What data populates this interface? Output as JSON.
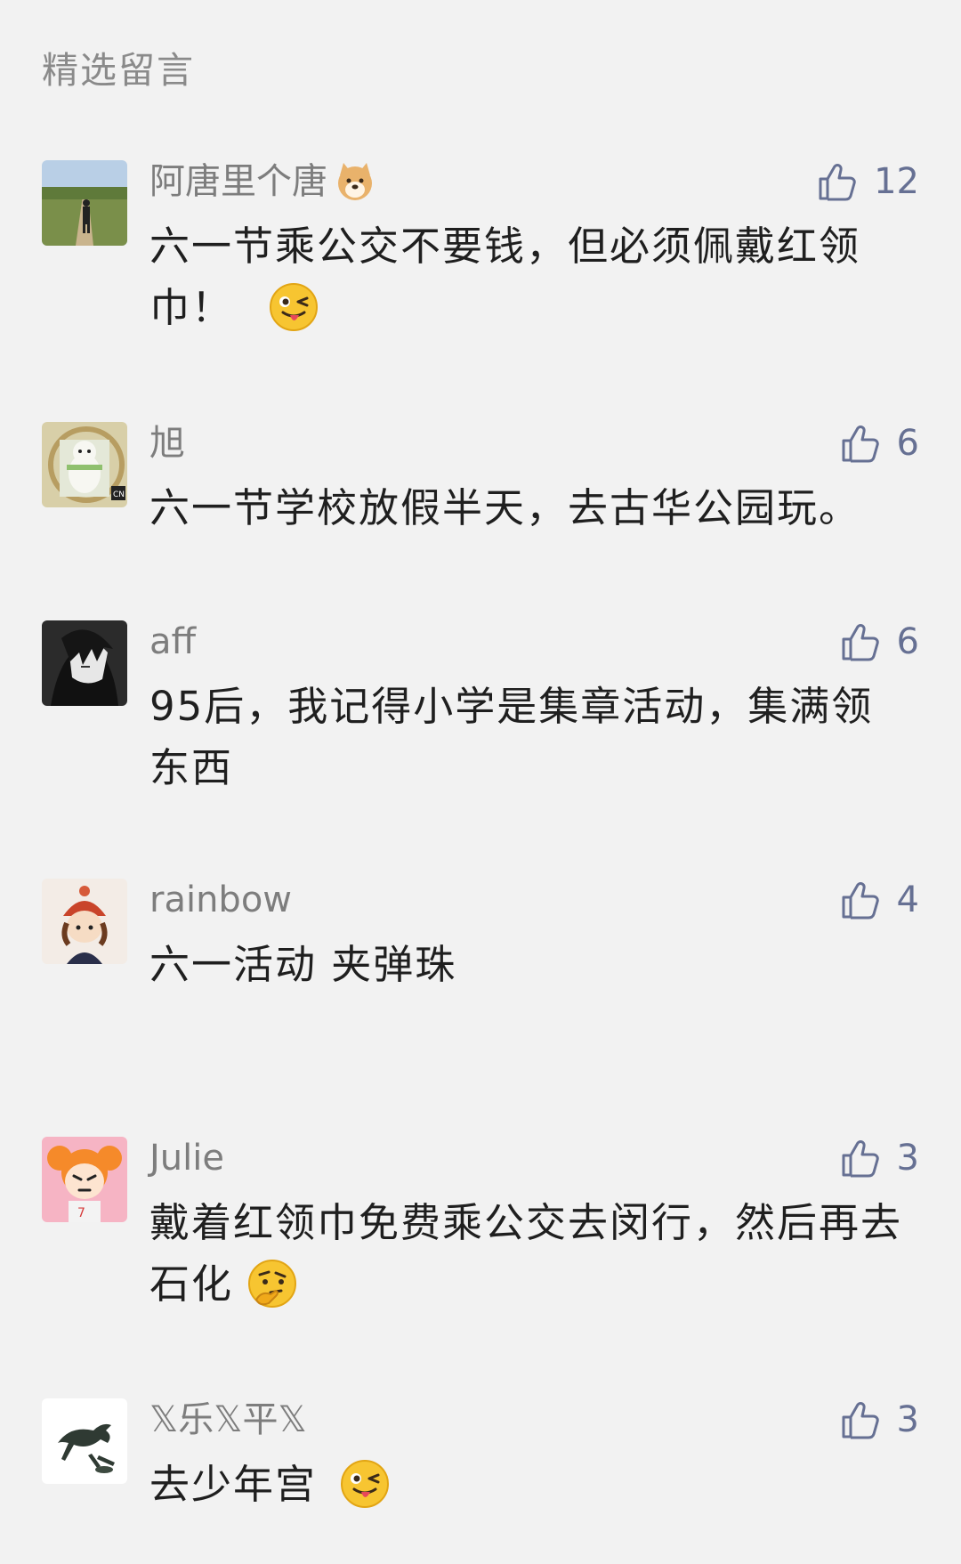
{
  "section_title": "精选留言",
  "comments": [
    {
      "name": "阿唐里个唐",
      "name_emoji": "dog-face-emoji",
      "likes": "12",
      "text": "六一节乘公交不要钱，但必须佩戴红领巾！",
      "text_emoji": "winking-tongue-emoji",
      "avatar": "road-walker-avatar"
    },
    {
      "name": "旭",
      "likes": "6",
      "text": "六一节学校放假半天，去古华公园玩。",
      "avatar": "polar-bear-cartoon-avatar"
    },
    {
      "name": "aff",
      "likes": "6",
      "text": "95后，我记得小学是集章活动，集满领东西",
      "avatar": "dark-anime-avatar"
    },
    {
      "name": "rainbow",
      "likes": "4",
      "text": "六一活动 夹弹珠",
      "avatar": "cartoon-girl-avatar"
    },
    {
      "name": "Julie",
      "likes": "3",
      "text": "戴着红领巾免费乘公交去闵行，然后再去石化",
      "text_emoji": "thinking-emoji",
      "avatar": "orange-hair-cartoon-avatar"
    },
    {
      "name": "𝕏乐𝕏平𝕏",
      "likes": "3",
      "text": "去少年宫",
      "text_emoji": "winking-tongue-emoji",
      "avatar": "bronze-horse-avatar"
    }
  ],
  "colors": {
    "background": "#f2f2f2",
    "name": "#7d7d7d",
    "like": "#667093",
    "text": "#1f1f1f"
  }
}
